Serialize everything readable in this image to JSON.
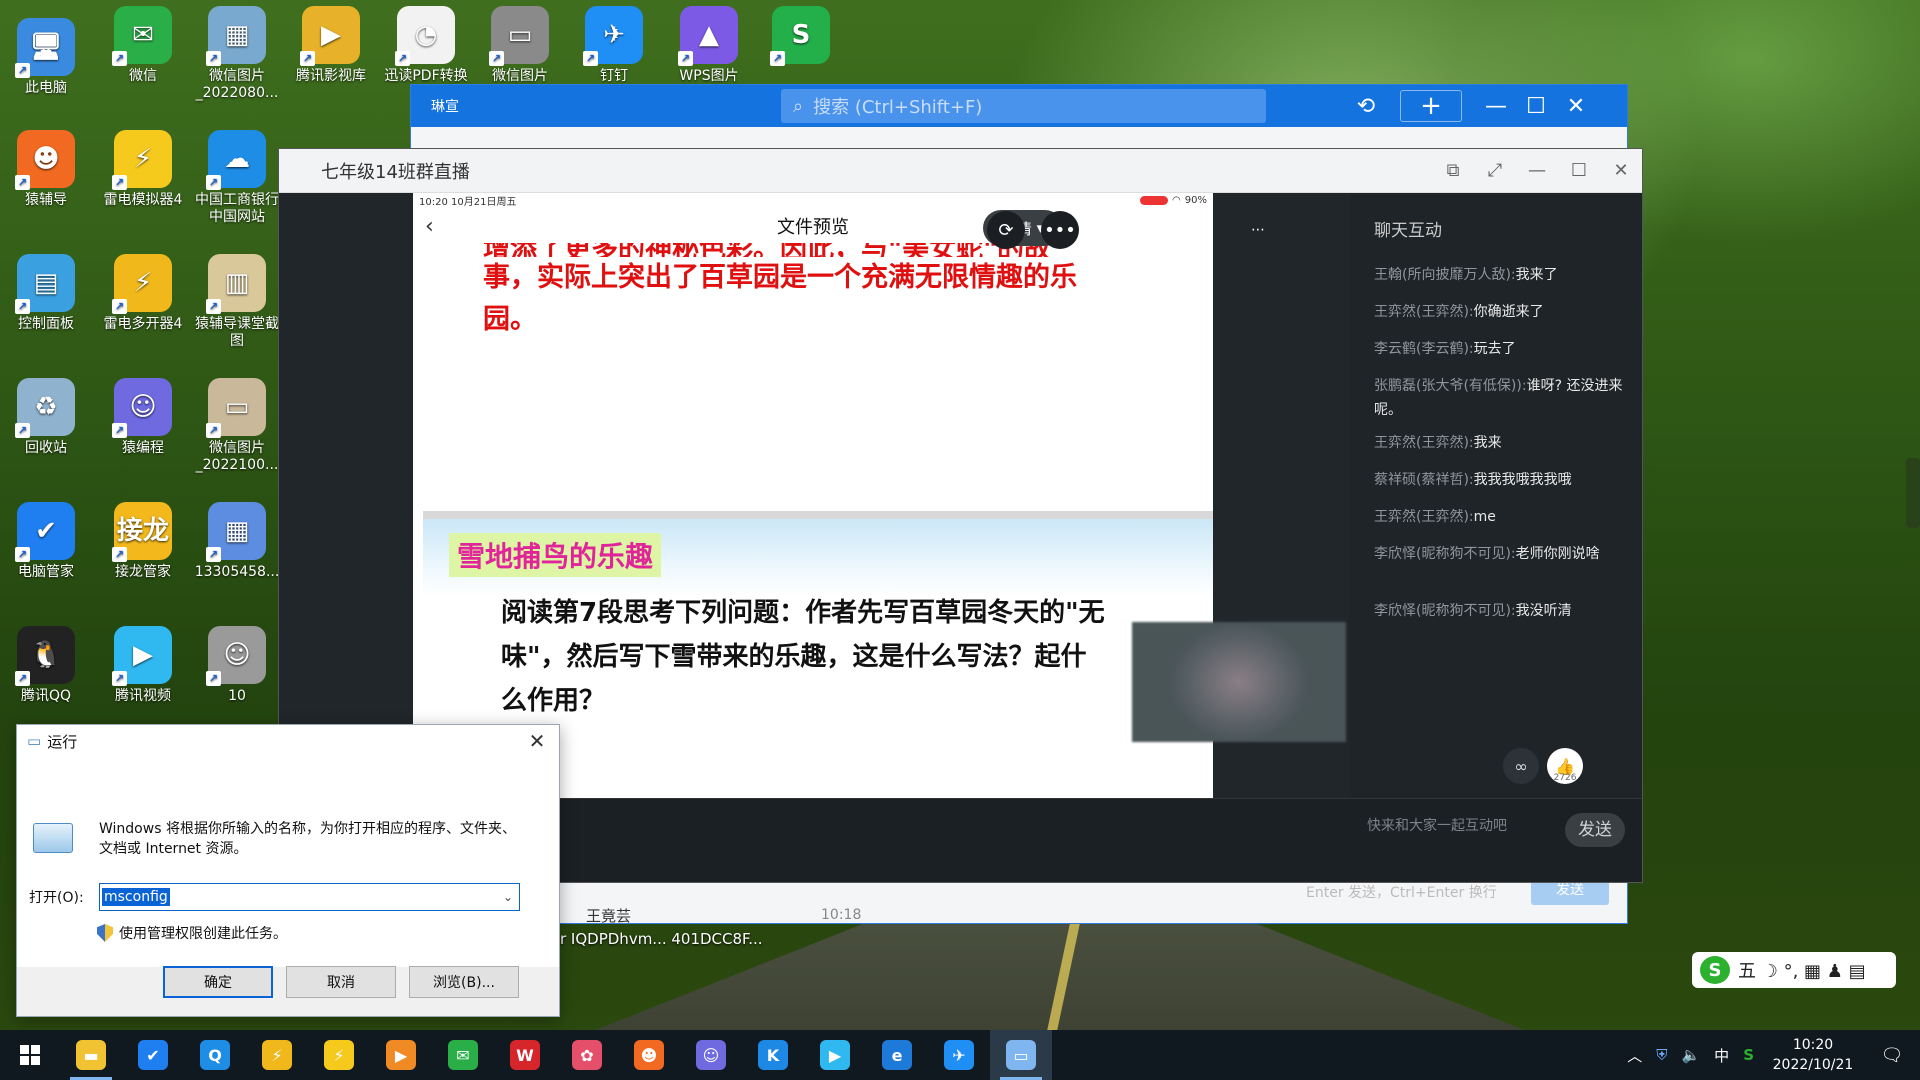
{
  "desktop": {
    "icons": [
      {
        "label": "此电脑",
        "glyph": "🖥",
        "color": "#3a8be0"
      },
      {
        "label": "微信",
        "glyph": "✉",
        "color": "#2aae47"
      },
      {
        "label": "微信图片\n_2022080...",
        "glyph": "▦",
        "color": "#7aa9cf"
      },
      {
        "label": "腾讯影视库",
        "glyph": "▶",
        "color": "#e7b22a"
      },
      {
        "label": "迅读PDF转换",
        "glyph": "◔",
        "color": "#f2f2f2"
      },
      {
        "label": "微信图片",
        "glyph": "▭",
        "color": "#8a8a8a"
      },
      {
        "label": "钉钉",
        "glyph": "✈",
        "color": "#1f8ef5"
      },
      {
        "label": "WPS图片",
        "glyph": "▲",
        "color": "#7d5ae6"
      },
      {
        "label": "",
        "glyph": "S",
        "color": "#23b04a"
      },
      {
        "label": "猿辅导",
        "glyph": "☻",
        "color": "#f26a21"
      },
      {
        "label": "雷电模拟器4",
        "glyph": "⚡",
        "color": "#f6c91d"
      },
      {
        "label": "中国工商银行\n中国网站",
        "glyph": "☁",
        "color": "#1e8de6"
      },
      {
        "label": "控制面板",
        "glyph": "▤",
        "color": "#3aa0e0"
      },
      {
        "label": "雷电多开器4",
        "glyph": "⚡",
        "color": "#f0b81b"
      },
      {
        "label": "猿辅导课堂截\n图",
        "glyph": "▥",
        "color": "#d9c89a"
      },
      {
        "label": "回收站",
        "glyph": "♻",
        "color": "#8fb3cf"
      },
      {
        "label": "猿编程",
        "glyph": "☺",
        "color": "#6f6ae0"
      },
      {
        "label": "微信图片\n_2022100...",
        "glyph": "▭",
        "color": "#c9b89a"
      },
      {
        "label": "电脑管家",
        "glyph": "✔",
        "color": "#1f7ef0"
      },
      {
        "label": "接龙管家",
        "glyph": "接龙",
        "color": "#f3b81c"
      },
      {
        "label": "13305458...",
        "glyph": "▦",
        "color": "#5d8de0"
      },
      {
        "label": "腾讯QQ",
        "glyph": "🐧",
        "color": "#222222"
      },
      {
        "label": "腾讯视频",
        "glyph": "▶",
        "color": "#2fb9f0"
      },
      {
        "label": "10",
        "glyph": "☺",
        "color": "#9a9a9a"
      }
    ]
  },
  "qq_window": {
    "title": "琳宣",
    "search_placeholder": "搜索 (Ctrl+Shift+F)",
    "peek_name": "王竟芸",
    "peek_time": "10:18",
    "input_hint": "Enter 发送，Ctrl+Enter 换行",
    "send_label": "发送",
    "file_peek": "r  IQDPDhvm...  401DCC8F..."
  },
  "live_window": {
    "title": "七年级14班群直播",
    "phone_status_left": "10:20  10月21日周五",
    "phone_status_right": "90%",
    "preview_title": "文件预览",
    "quality_label": "超清",
    "slide1_lines": [
      "增添了更多的神秘色彩。因此，与\"美女蛇\"的故",
      "事，实际上突出了百草园是一个充满无限情趣的乐",
      "园。"
    ],
    "slide2_heading": "雪地捕鸟的乐趣",
    "slide2_body": "阅读第7段思考下列问题：作者先写百草园冬天的\"无味\"，然后写下雪带来的乐趣，这是什么写法？起什么作用？",
    "chat_title": "聊天互动",
    "messages": [
      {
        "name": "王翰(所向披靡万人敌):",
        "text": "我来了"
      },
      {
        "name": "王弈然(王弈然):",
        "text": "你确逝来了"
      },
      {
        "name": "李云鹤(李云鹤):",
        "text": "玩去了"
      },
      {
        "name": "张鹏磊(张大爷(有低保)):",
        "text": "谁呀? 还没进来呢。"
      },
      {
        "name": "王弈然(王弈然):",
        "text": "我来"
      },
      {
        "name": "蔡祥硕(蔡祥哲):",
        "text": "我我我哦我我哦"
      },
      {
        "name": "王弈然(王弈然):",
        "text": "me"
      },
      {
        "name": "李欣怿(昵称狗不可见):",
        "text": "老师你刚说啥"
      },
      {
        "name": "李欣怿(昵称狗不可见):",
        "text": "我没听清"
      }
    ],
    "likes_count": "2726",
    "input_placeholder": "快来和大家一起互动吧",
    "send_label": "发送"
  },
  "run_dialog": {
    "title": "运行",
    "description": "Windows 将根据你所输入的名称，为你打开相应的程序、文件夹、文档或 Internet 资源。",
    "open_label": "打开(O):",
    "value": "msconfig",
    "admin_note": "使用管理权限创建此任务。",
    "ok": "确定",
    "cancel": "取消",
    "browse": "浏览(B)..."
  },
  "ime": {
    "logo": "S",
    "mode": "五 ☽ °, ▦ ♟ ▤"
  },
  "taskbar": {
    "apps": [
      {
        "name": "file-explorer-icon",
        "glyph": "▬",
        "color": "#f1c232"
      },
      {
        "name": "pc-manager-icon",
        "glyph": "✔",
        "color": "#1f7ef0"
      },
      {
        "name": "browser-q-icon",
        "glyph": "Q",
        "color": "#1e8de6"
      },
      {
        "name": "ldmulti-icon",
        "glyph": "⚡",
        "color": "#f0b81b"
      },
      {
        "name": "ldplayer-icon",
        "glyph": "⚡",
        "color": "#f6c91d"
      },
      {
        "name": "video-icon",
        "glyph": "▶",
        "color": "#f08a24"
      },
      {
        "name": "wechat-icon",
        "glyph": "✉",
        "color": "#2aae47"
      },
      {
        "name": "wps-icon",
        "glyph": "W",
        "color": "#d7262b"
      },
      {
        "name": "pinwheel-icon",
        "glyph": "✿",
        "color": "#e54f6a"
      },
      {
        "name": "yuanfudao-icon",
        "glyph": "☻",
        "color": "#f26a21"
      },
      {
        "name": "yuanbiancheng-icon",
        "glyph": "☺",
        "color": "#6f6ae0"
      },
      {
        "name": "kugou-icon",
        "glyph": "K",
        "color": "#1e88e5"
      },
      {
        "name": "tencent-video-icon",
        "glyph": "▶",
        "color": "#2fb9f0"
      },
      {
        "name": "ie-icon",
        "glyph": "e",
        "color": "#1e7ad8"
      },
      {
        "name": "dingtalk-icon",
        "glyph": "✈",
        "color": "#1f8ef5"
      },
      {
        "name": "run-icon",
        "glyph": "▭",
        "color": "#7fb6f0"
      }
    ],
    "tray_input": "中",
    "time": "10:20",
    "date": "2022/10/21"
  }
}
